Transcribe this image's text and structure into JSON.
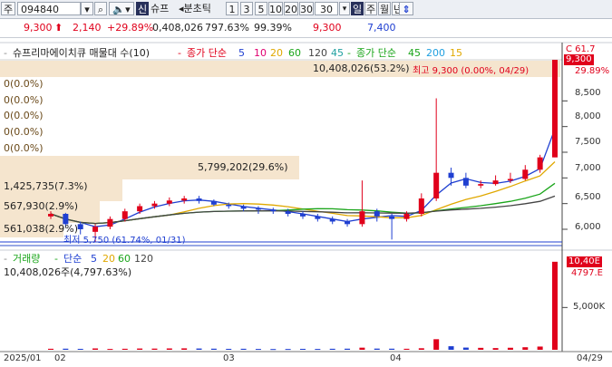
{
  "toolbar": {
    "market_label": "주",
    "code_value": "094840",
    "new_label": "신",
    "name_label": "슈프",
    "period_label": "분초틱",
    "period_options": [
      "1",
      "3",
      "5",
      "10",
      "20",
      "30"
    ],
    "period_input": "30",
    "day_label": "일",
    "week_label": "주",
    "month_label": "월",
    "year_label": "년"
  },
  "quote": {
    "price": "9,300",
    "change": "2,140",
    "change_rate": "+29.89%",
    "volume": "0,408,026",
    "volume_rate": "797.63%",
    "strength": "99.39%",
    "high": "9,300",
    "low": "7,400"
  },
  "legend": {
    "title": "슈프리마에이치큐 매물대 수(10)",
    "ma_label": "종가 단순",
    "ma_periods": [
      "5",
      "10",
      "20",
      "60",
      "120"
    ],
    "ma_long": "45",
    "ma2_label": "종가 단순",
    "ma2_periods": [
      "45",
      "200",
      "15"
    ]
  },
  "volume_legend": {
    "label": "거래량",
    "ma_label": "단순",
    "periods": [
      "5",
      "20",
      "60",
      "120"
    ]
  },
  "annotations": {
    "top_volume": "10,408,026(53.2%)",
    "top_high": "최고 9,300 (0.00%, 04/29)",
    "mid_volume": "5,799,202(29.6%)",
    "profile_1": "1,425,735(7.3%)",
    "profile_2": "567,930(2.9%)",
    "profile_3": "561,038(2.9%)",
    "low_label": "최저 5,750 (61.74%, 01/31)",
    "volume_today": "10,408,026주(4,797.63%)",
    "empty_rows": [
      "0(0.0%)",
      "0(0.0%)",
      "0(0.0%)",
      "0(0.0%)",
      "0(0.0%)"
    ]
  },
  "price_axis": {
    "ticks": [
      "8,500",
      "8,000",
      "7,500",
      "7,000",
      "6,500",
      "6,000"
    ],
    "top_label": "29.89%",
    "current_tag": "9,300",
    "clipped_label": "C 61.7"
  },
  "volume_axis": {
    "tick": "5,000K",
    "current_tag": "10,40E",
    "rate_label": "4797.E"
  },
  "date_axis": {
    "labels": [
      "2025/01",
      "02",
      "03",
      "04",
      "04/29"
    ]
  },
  "colors": {
    "up": "#e0001b",
    "down": "#1f3fd1",
    "profile": "#f3dfc2"
  },
  "chart_data": {
    "type": "candlestick",
    "dates": [
      "01/20",
      "01/22",
      "01/24",
      "01/31",
      "02/04",
      "02/06",
      "02/10",
      "02/12",
      "02/14",
      "02/18",
      "02/20",
      "02/24",
      "02/26",
      "03/04",
      "03/06",
      "03/10",
      "03/12",
      "03/14",
      "03/18",
      "03/20",
      "03/24",
      "03/26",
      "03/28",
      "04/01",
      "04/03",
      "04/07",
      "04/09",
      "04/11",
      "04/15",
      "04/17",
      "04/21",
      "04/23",
      "04/25",
      "04/28",
      "04/29"
    ],
    "open": [
      6250,
      6300,
      6100,
      5950,
      6050,
      6200,
      6350,
      6450,
      6500,
      6560,
      6600,
      6550,
      6480,
      6450,
      6400,
      6380,
      6350,
      6300,
      6250,
      6200,
      6150,
      6100,
      6350,
      6250,
      6200,
      6300,
      6600,
      7100,
      7000,
      6850,
      6880,
      6950,
      6980,
      7160,
      7400
    ],
    "close": [
      6300,
      6100,
      6000,
      6050,
      6200,
      6350,
      6450,
      6500,
      6560,
      6600,
      6550,
      6480,
      6450,
      6400,
      6380,
      6350,
      6300,
      6250,
      6200,
      6150,
      6100,
      6350,
      6250,
      6200,
      6300,
      6600,
      7100,
      7000,
      6850,
      6880,
      6950,
      6980,
      7160,
      7400,
      9300
    ],
    "high": [
      6350,
      6320,
      6150,
      6100,
      6250,
      6400,
      6500,
      6550,
      6620,
      6650,
      6650,
      6580,
      6520,
      6480,
      6450,
      6420,
      6400,
      6350,
      6300,
      6250,
      6200,
      6950,
      6400,
      6300,
      6350,
      6700,
      8550,
      7200,
      7100,
      6950,
      7050,
      7100,
      7250,
      7450,
      9300
    ],
    "low": [
      6200,
      6050,
      5900,
      5750,
      6000,
      6150,
      6300,
      6400,
      6450,
      6500,
      6500,
      6450,
      6400,
      6350,
      6300,
      6300,
      6250,
      6200,
      6150,
      6100,
      6050,
      6050,
      6150,
      5800,
      6150,
      6250,
      6550,
      6850,
      6800,
      6800,
      6850,
      6900,
      6950,
      7100,
      7400
    ],
    "volume_k": [
      120,
      130,
      110,
      160,
      100,
      120,
      150,
      140,
      160,
      170,
      150,
      130,
      110,
      120,
      100,
      90,
      95,
      110,
      100,
      120,
      130,
      250,
      140,
      130,
      120,
      180,
      1250,
      420,
      260,
      230,
      200,
      240,
      300,
      380,
      10408
    ],
    "ma_series": [
      {
        "name": "5",
        "color": "#1f3fd1"
      },
      {
        "name": "20",
        "color": "#e0a800"
      },
      {
        "name": "60",
        "color": "#1aa51a"
      },
      {
        "name": "120",
        "color": "#444444"
      }
    ],
    "ylim": [
      5700,
      9300
    ],
    "volume_ylim": [
      0,
      10500
    ]
  }
}
